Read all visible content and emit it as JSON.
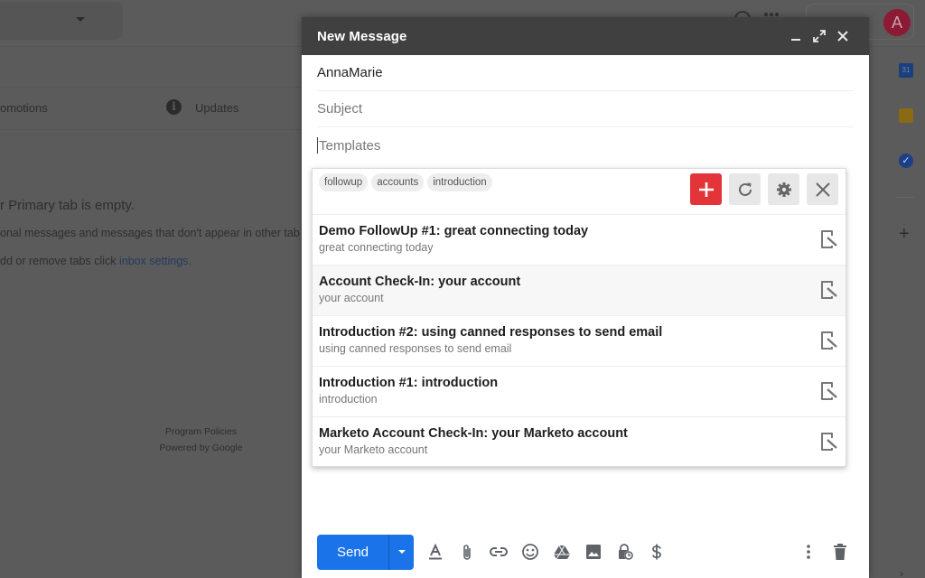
{
  "background": {
    "tabs": [
      {
        "label": "omotions"
      },
      {
        "label": "Updates"
      }
    ],
    "empty_title": "r Primary tab is empty.",
    "empty_line1": "onal messages and messages that don't appear in other tab",
    "empty_line2_prefix": "dd or remove tabs click ",
    "empty_line2_link": "inbox settings",
    "empty_line2_suffix": ".",
    "footer_policies": "Program Policies",
    "footer_powered": "Powered by Google",
    "avatar_letter": "A",
    "calendar_day": "31"
  },
  "compose": {
    "title": "New Message",
    "to_value": "AnnaMarie",
    "subject_placeholder": "Subject",
    "templates_placeholder": "Templates",
    "send_label": "Send"
  },
  "templates": {
    "tags": [
      "followup",
      "accounts",
      "introduction"
    ],
    "items": [
      {
        "title": "Demo FollowUp #1: great connecting today",
        "subtitle": "great connecting today"
      },
      {
        "title": "Account Check-In: your account",
        "subtitle": "your account"
      },
      {
        "title": "Introduction #2: using canned responses to send email",
        "subtitle": "using canned responses to send email"
      },
      {
        "title": "Introduction #1: introduction",
        "subtitle": "introduction"
      },
      {
        "title": "Marketo Account Check-In: your Marketo account",
        "subtitle": "your Marketo account"
      }
    ]
  },
  "colors": {
    "send": "#1a73e8",
    "add_template": "#e3343a",
    "header": "#404040"
  }
}
